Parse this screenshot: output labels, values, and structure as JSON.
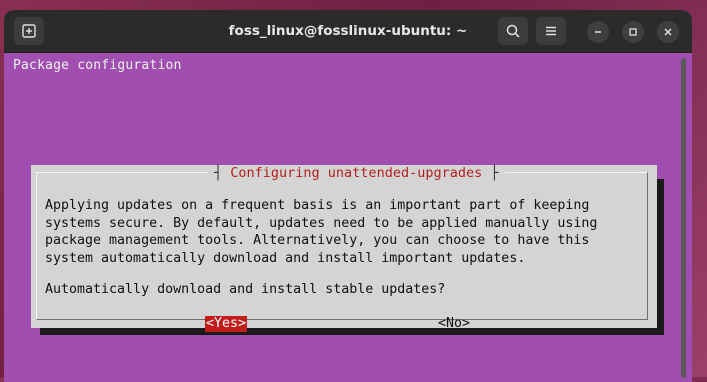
{
  "window": {
    "title": "foss_linux@fosslinux-ubuntu: ~",
    "icons": [
      "new-tab-icon",
      "search-icon",
      "menu-icon",
      "minimize-icon",
      "maximize-icon",
      "close-icon"
    ]
  },
  "terminal": {
    "header": "Package configuration"
  },
  "dialog": {
    "title": "Configuring unattended-upgrades",
    "body": "Applying updates on a frequent basis is an important part of keeping\nsystems secure. By default, updates need to be applied manually using\npackage management tools. Alternatively, you can choose to have this\nsystem automatically download and install important updates.",
    "question": "Automatically download and install stable updates?",
    "yes_label": "<Yes>",
    "no_label": "<No>"
  },
  "colors": {
    "terminal_bg": "#a04fb0",
    "dialog_bg": "#d4d4d4",
    "title_red": "#b42020",
    "selected_button": "#c21d1d",
    "titlebar": "#2b2b2b"
  }
}
